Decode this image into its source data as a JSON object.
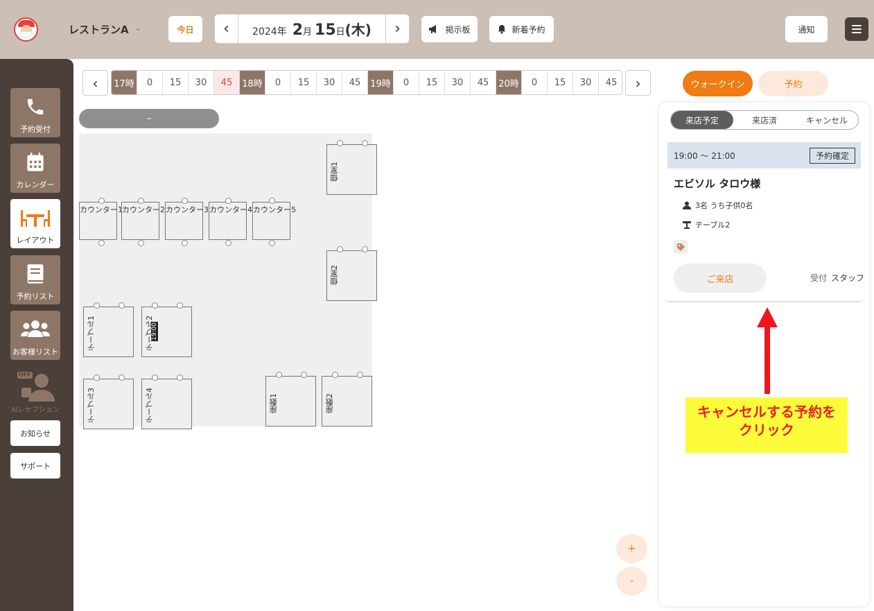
{
  "header": {
    "store_name": "レストランA",
    "today_label": "今日",
    "date": {
      "year": "2024年",
      "month": "2",
      "month_unit": "月",
      "day": "15",
      "day_unit": "日",
      "weekday": "(木)"
    },
    "board_label": "掲示板",
    "new_reservation_label": "新着予約",
    "notify_label": "通知"
  },
  "sidebar": {
    "items": [
      {
        "label": "予約受付",
        "icon": "phone-icon"
      },
      {
        "label": "カレンダー",
        "icon": "calendar-icon"
      },
      {
        "label": "レイアウト",
        "icon": "table-layout-icon"
      },
      {
        "label": "予約リスト",
        "icon": "book-icon"
      },
      {
        "label": "お客様リスト",
        "icon": "users-icon"
      }
    ],
    "ai_label": "AIレセプション",
    "ai_badge": "OFF",
    "news_label": "お知らせ",
    "support_label": "サポート"
  },
  "timeline": {
    "cells": [
      "17時",
      "0",
      "15",
      "30",
      "45",
      "18時",
      "0",
      "15",
      "30",
      "45",
      "19時",
      "0",
      "15",
      "30",
      "45",
      "20時",
      "0",
      "15",
      "30",
      "45"
    ],
    "hour_indices": [
      0,
      5,
      10,
      15
    ],
    "highlight_index": 4
  },
  "floor": {
    "area_tab": "–",
    "tables": [
      {
        "name": "カウンター1"
      },
      {
        "name": "カウンター2"
      },
      {
        "name": "カウンター3"
      },
      {
        "name": "カウンター4"
      },
      {
        "name": "カウンター5"
      },
      {
        "name": "個室1"
      },
      {
        "name": "個室2"
      },
      {
        "name": "テーブル1"
      },
      {
        "name": "テーブル2",
        "badge": "19:00"
      },
      {
        "name": "テーブル3"
      },
      {
        "name": "テーブル4"
      },
      {
        "name": "座敷1"
      },
      {
        "name": "座敷2"
      }
    ]
  },
  "zoom": {
    "plus": "+",
    "minus": "-"
  },
  "panel": {
    "walkin_label": "ウォークイン",
    "reserve_label": "予約",
    "tabs": [
      "来店予定",
      "来店済",
      "キャンセル"
    ],
    "active_tab": 0,
    "reservation": {
      "time": "19:00 〜 21:00",
      "status": "予約確定",
      "guest_name": "エビソル タロウ様",
      "party": "3名 うち子供0名",
      "table": "テーブル2",
      "visit_label": "ご来店",
      "reception_key": "受付",
      "reception_value": "スタッフ"
    }
  },
  "annotation": {
    "text_line1": "キャンセルする予約を",
    "text_line2": "クリック",
    "arrow_color": "#f0141e",
    "box_color": "#fdfc3b"
  },
  "colors": {
    "header_bg": "#cbbfb6",
    "sidebar_bg": "#4a3f39",
    "accent_orange": "#ef7b12",
    "hour_brown": "#8e7667"
  }
}
